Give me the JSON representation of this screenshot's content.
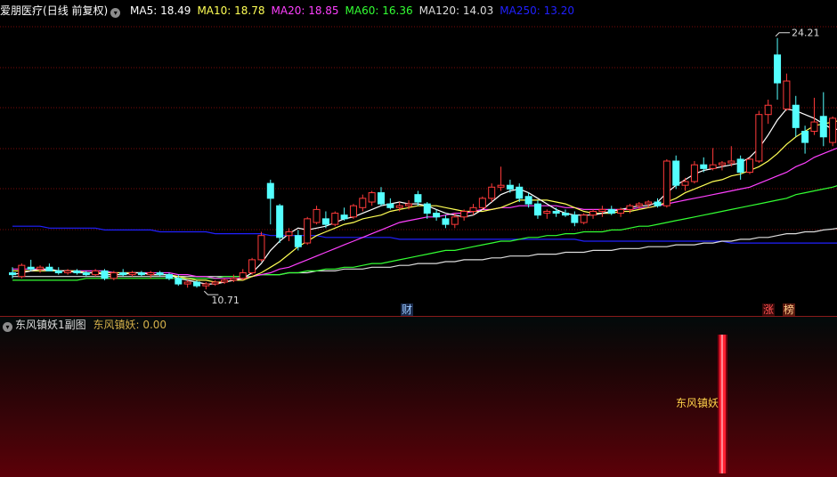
{
  "header": {
    "stock_name": "爱朋医疗",
    "period": "(日线 前复权)",
    "ma": [
      {
        "label": "MA5:",
        "value": "18.49",
        "color": "#ffffff"
      },
      {
        "label": "MA10:",
        "value": "18.78",
        "color": "#ffff55"
      },
      {
        "label": "MA20:",
        "value": "18.85",
        "color": "#ff40ff"
      },
      {
        "label": "MA60:",
        "value": "16.36",
        "color": "#33ff33"
      },
      {
        "label": "MA120:",
        "value": "14.03",
        "color": "#dddddd"
      },
      {
        "label": "MA250:",
        "value": "13.20",
        "color": "#2020ff"
      }
    ]
  },
  "sub_header": {
    "title": "东风镇妖1副图",
    "indicator_label": "东风镇妖:",
    "indicator_value": "0.00"
  },
  "annotations": {
    "high_label": "24.21",
    "low_label": "10.71",
    "fin_tag": "财",
    "zhang_tag": "涨",
    "bang_tag": "榜",
    "signal_label": "东风镇妖"
  },
  "colors": {
    "up": "#ff3a3a",
    "down": "#54ffff",
    "ma5": "#ffffff",
    "ma10": "#ffff55",
    "ma20": "#ff40ff",
    "ma60": "#33ff33",
    "ma120": "#dddddd",
    "ma250": "#2020ff",
    "grid": "#7a0a0a",
    "signal": "#ff2030"
  },
  "chart_data": {
    "type": "candlestick",
    "price_range": [
      10.0,
      25.2
    ],
    "high_marker": 24.21,
    "low_marker": 10.71,
    "candles": [
      {
        "o": 11.6,
        "h": 11.9,
        "l": 11.3,
        "c": 11.5
      },
      {
        "o": 11.4,
        "h": 12.1,
        "l": 11.3,
        "c": 12.0
      },
      {
        "o": 11.9,
        "h": 12.3,
        "l": 11.7,
        "c": 11.8
      },
      {
        "o": 11.8,
        "h": 12.0,
        "l": 11.6,
        "c": 11.9
      },
      {
        "o": 11.9,
        "h": 12.1,
        "l": 11.7,
        "c": 11.7
      },
      {
        "o": 11.7,
        "h": 11.9,
        "l": 11.5,
        "c": 11.6
      },
      {
        "o": 11.6,
        "h": 11.8,
        "l": 11.5,
        "c": 11.7
      },
      {
        "o": 11.7,
        "h": 11.8,
        "l": 11.5,
        "c": 11.6
      },
      {
        "o": 11.6,
        "h": 11.7,
        "l": 11.4,
        "c": 11.5
      },
      {
        "o": 11.5,
        "h": 11.8,
        "l": 11.4,
        "c": 11.7
      },
      {
        "o": 11.7,
        "h": 11.8,
        "l": 11.2,
        "c": 11.3
      },
      {
        "o": 11.3,
        "h": 11.7,
        "l": 11.2,
        "c": 11.6
      },
      {
        "o": 11.6,
        "h": 11.8,
        "l": 11.4,
        "c": 11.5
      },
      {
        "o": 11.5,
        "h": 11.7,
        "l": 11.4,
        "c": 11.6
      },
      {
        "o": 11.6,
        "h": 11.7,
        "l": 11.4,
        "c": 11.5
      },
      {
        "o": 11.5,
        "h": 11.7,
        "l": 11.3,
        "c": 11.6
      },
      {
        "o": 11.6,
        "h": 11.7,
        "l": 11.4,
        "c": 11.5
      },
      {
        "o": 11.5,
        "h": 11.6,
        "l": 11.2,
        "c": 11.3
      },
      {
        "o": 11.3,
        "h": 11.5,
        "l": 10.9,
        "c": 11.0
      },
      {
        "o": 11.0,
        "h": 11.2,
        "l": 10.8,
        "c": 11.1
      },
      {
        "o": 11.1,
        "h": 11.2,
        "l": 10.8,
        "c": 10.9
      },
      {
        "o": 10.9,
        "h": 11.1,
        "l": 10.71,
        "c": 11.0
      },
      {
        "o": 11.0,
        "h": 11.2,
        "l": 10.9,
        "c": 11.1
      },
      {
        "o": 11.1,
        "h": 11.3,
        "l": 11.0,
        "c": 11.2
      },
      {
        "o": 11.2,
        "h": 11.5,
        "l": 11.1,
        "c": 11.3
      },
      {
        "o": 11.3,
        "h": 11.8,
        "l": 11.2,
        "c": 11.6
      },
      {
        "o": 11.6,
        "h": 12.4,
        "l": 11.5,
        "c": 12.3
      },
      {
        "o": 12.3,
        "h": 13.8,
        "l": 12.2,
        "c": 13.6
      },
      {
        "o": 16.4,
        "h": 16.6,
        "l": 14.2,
        "c": 15.6
      },
      {
        "o": 15.2,
        "h": 15.3,
        "l": 13.2,
        "c": 13.5
      },
      {
        "o": 13.6,
        "h": 14.0,
        "l": 13.3,
        "c": 13.8
      },
      {
        "o": 13.6,
        "h": 13.9,
        "l": 12.8,
        "c": 13.0
      },
      {
        "o": 13.2,
        "h": 14.6,
        "l": 13.1,
        "c": 14.5
      },
      {
        "o": 14.3,
        "h": 15.2,
        "l": 14.2,
        "c": 15.0
      },
      {
        "o": 14.5,
        "h": 14.9,
        "l": 14.0,
        "c": 14.2
      },
      {
        "o": 14.2,
        "h": 14.9,
        "l": 14.1,
        "c": 14.8
      },
      {
        "o": 14.7,
        "h": 15.1,
        "l": 14.4,
        "c": 14.5
      },
      {
        "o": 14.6,
        "h": 15.3,
        "l": 14.5,
        "c": 15.2
      },
      {
        "o": 15.1,
        "h": 15.8,
        "l": 14.9,
        "c": 15.6
      },
      {
        "o": 15.4,
        "h": 16.0,
        "l": 15.2,
        "c": 15.9
      },
      {
        "o": 15.9,
        "h": 16.2,
        "l": 15.2,
        "c": 15.3
      },
      {
        "o": 15.3,
        "h": 15.6,
        "l": 15.0,
        "c": 15.1
      },
      {
        "o": 15.1,
        "h": 15.4,
        "l": 14.9,
        "c": 15.2
      },
      {
        "o": 15.2,
        "h": 15.5,
        "l": 15.0,
        "c": 15.3
      },
      {
        "o": 15.8,
        "h": 16.0,
        "l": 15.2,
        "c": 15.4
      },
      {
        "o": 15.3,
        "h": 15.4,
        "l": 14.5,
        "c": 14.8
      },
      {
        "o": 14.8,
        "h": 15.0,
        "l": 14.4,
        "c": 14.6
      },
      {
        "o": 14.5,
        "h": 14.7,
        "l": 14.0,
        "c": 14.2
      },
      {
        "o": 14.2,
        "h": 14.8,
        "l": 14.0,
        "c": 14.6
      },
      {
        "o": 14.6,
        "h": 15.0,
        "l": 14.4,
        "c": 14.9
      },
      {
        "o": 14.9,
        "h": 15.3,
        "l": 14.7,
        "c": 15.1
      },
      {
        "o": 15.1,
        "h": 15.7,
        "l": 15.0,
        "c": 15.6
      },
      {
        "o": 15.6,
        "h": 16.4,
        "l": 15.4,
        "c": 16.2
      },
      {
        "o": 16.2,
        "h": 17.3,
        "l": 16.0,
        "c": 16.3
      },
      {
        "o": 16.3,
        "h": 16.6,
        "l": 15.9,
        "c": 16.1
      },
      {
        "o": 16.2,
        "h": 16.4,
        "l": 15.4,
        "c": 15.6
      },
      {
        "o": 15.7,
        "h": 15.9,
        "l": 15.1,
        "c": 15.3
      },
      {
        "o": 15.3,
        "h": 15.5,
        "l": 14.5,
        "c": 14.7
      },
      {
        "o": 14.8,
        "h": 15.0,
        "l": 14.5,
        "c": 14.9
      },
      {
        "o": 14.9,
        "h": 15.1,
        "l": 14.6,
        "c": 14.8
      },
      {
        "o": 14.8,
        "h": 15.0,
        "l": 14.6,
        "c": 14.7
      },
      {
        "o": 14.7,
        "h": 14.9,
        "l": 14.1,
        "c": 14.3
      },
      {
        "o": 14.3,
        "h": 14.8,
        "l": 14.2,
        "c": 14.7
      },
      {
        "o": 14.7,
        "h": 15.0,
        "l": 14.5,
        "c": 14.9
      },
      {
        "o": 14.9,
        "h": 15.2,
        "l": 14.6,
        "c": 15.0
      },
      {
        "o": 15.0,
        "h": 15.2,
        "l": 14.7,
        "c": 14.8
      },
      {
        "o": 14.8,
        "h": 15.1,
        "l": 14.6,
        "c": 15.0
      },
      {
        "o": 15.0,
        "h": 15.3,
        "l": 14.8,
        "c": 15.2
      },
      {
        "o": 15.2,
        "h": 15.4,
        "l": 15.0,
        "c": 15.3
      },
      {
        "o": 15.3,
        "h": 15.5,
        "l": 15.1,
        "c": 15.4
      },
      {
        "o": 15.4,
        "h": 15.6,
        "l": 15.1,
        "c": 15.2
      },
      {
        "o": 15.2,
        "h": 17.7,
        "l": 15.1,
        "c": 17.6
      },
      {
        "o": 17.6,
        "h": 17.9,
        "l": 16.1,
        "c": 16.3
      },
      {
        "o": 16.3,
        "h": 16.7,
        "l": 16.0,
        "c": 16.5
      },
      {
        "o": 16.5,
        "h": 17.6,
        "l": 16.4,
        "c": 17.4
      },
      {
        "o": 17.4,
        "h": 17.8,
        "l": 17.0,
        "c": 17.2
      },
      {
        "o": 17.2,
        "h": 18.3,
        "l": 17.1,
        "c": 17.4
      },
      {
        "o": 17.4,
        "h": 17.6,
        "l": 17.1,
        "c": 17.5
      },
      {
        "o": 17.5,
        "h": 18.4,
        "l": 17.3,
        "c": 17.6
      },
      {
        "o": 17.7,
        "h": 17.9,
        "l": 16.6,
        "c": 17.0
      },
      {
        "o": 17.0,
        "h": 17.8,
        "l": 16.9,
        "c": 17.7
      },
      {
        "o": 17.6,
        "h": 20.3,
        "l": 17.5,
        "c": 20.1
      },
      {
        "o": 20.1,
        "h": 20.9,
        "l": 19.6,
        "c": 20.6
      },
      {
        "o": 23.3,
        "h": 24.21,
        "l": 20.9,
        "c": 21.8
      },
      {
        "o": 20.4,
        "h": 22.3,
        "l": 20.3,
        "c": 21.9
      },
      {
        "o": 20.6,
        "h": 21.1,
        "l": 18.9,
        "c": 19.4
      },
      {
        "o": 19.2,
        "h": 19.5,
        "l": 18.0,
        "c": 18.6
      },
      {
        "o": 19.2,
        "h": 21.0,
        "l": 19.0,
        "c": 19.7
      },
      {
        "o": 20.0,
        "h": 21.3,
        "l": 18.4,
        "c": 18.9
      },
      {
        "o": 18.6,
        "h": 20.0,
        "l": 18.4,
        "c": 19.9
      }
    ],
    "ma_lines": {
      "ma5": [
        11.5,
        11.6,
        11.7,
        11.8,
        11.8,
        11.7,
        11.7,
        11.6,
        11.6,
        11.6,
        11.5,
        11.5,
        11.5,
        11.6,
        11.6,
        11.5,
        11.5,
        11.5,
        11.3,
        11.2,
        11.1,
        11.0,
        11.0,
        11.1,
        11.2,
        11.3,
        11.6,
        12.1,
        12.8,
        13.3,
        13.7,
        14.0,
        13.9,
        14.0,
        14.1,
        14.3,
        14.5,
        14.6,
        14.8,
        15.0,
        15.2,
        15.3,
        15.4,
        15.3,
        15.3,
        15.2,
        15.0,
        14.8,
        14.7,
        14.6,
        14.7,
        15.0,
        15.4,
        15.8,
        16.0,
        16.1,
        15.9,
        15.6,
        15.3,
        15.0,
        14.8,
        14.7,
        14.7,
        14.7,
        14.8,
        14.9,
        15.0,
        15.1,
        15.2,
        15.2,
        15.4,
        15.9,
        16.3,
        16.6,
        16.9,
        17.1,
        17.2,
        17.3,
        17.4,
        17.5,
        17.8,
        18.3,
        19.0,
        19.8,
        20.4,
        20.3,
        20.1,
        19.9,
        19.6,
        19.3,
        19.3
      ],
      "ma10": [
        11.7,
        11.7,
        11.7,
        11.7,
        11.7,
        11.7,
        11.7,
        11.7,
        11.6,
        11.6,
        11.6,
        11.6,
        11.6,
        11.6,
        11.6,
        11.5,
        11.5,
        11.5,
        11.4,
        11.3,
        11.2,
        11.2,
        11.1,
        11.1,
        11.2,
        11.2,
        11.4,
        11.6,
        11.9,
        12.2,
        12.6,
        13.0,
        13.3,
        13.6,
        13.8,
        14.0,
        14.2,
        14.3,
        14.5,
        14.6,
        14.7,
        14.9,
        15.0,
        15.1,
        15.2,
        15.2,
        15.2,
        15.1,
        15.0,
        14.9,
        14.9,
        14.9,
        15.0,
        15.1,
        15.3,
        15.5,
        15.5,
        15.5,
        15.5,
        15.4,
        15.3,
        15.1,
        14.9,
        14.8,
        14.8,
        14.8,
        14.9,
        14.9,
        15.0,
        15.1,
        15.2,
        15.4,
        15.6,
        15.9,
        16.1,
        16.3,
        16.5,
        16.6,
        16.8,
        16.9,
        17.1,
        17.3,
        17.6,
        18.0,
        18.5,
        18.9,
        19.2,
        19.5,
        19.6,
        19.7,
        19.8
      ],
      "ma20": [
        11.8,
        11.8,
        11.8,
        11.8,
        11.7,
        11.7,
        11.7,
        11.7,
        11.7,
        11.7,
        11.7,
        11.6,
        11.6,
        11.6,
        11.6,
        11.6,
        11.6,
        11.6,
        11.5,
        11.5,
        11.4,
        11.4,
        11.3,
        11.3,
        11.3,
        11.3,
        11.4,
        11.5,
        11.6,
        11.8,
        11.9,
        12.1,
        12.3,
        12.5,
        12.7,
        12.9,
        13.1,
        13.3,
        13.5,
        13.7,
        13.9,
        14.1,
        14.3,
        14.4,
        14.5,
        14.6,
        14.6,
        14.7,
        14.8,
        14.8,
        14.9,
        15.0,
        15.0,
        15.1,
        15.1,
        15.2,
        15.2,
        15.2,
        15.2,
        15.2,
        15.1,
        15.1,
        15.0,
        15.0,
        15.0,
        15.0,
        15.0,
        15.0,
        15.1,
        15.1,
        15.2,
        15.3,
        15.4,
        15.5,
        15.6,
        15.7,
        15.8,
        15.9,
        16.0,
        16.1,
        16.2,
        16.4,
        16.6,
        16.8,
        17.0,
        17.3,
        17.5,
        17.8,
        18.0,
        18.2,
        18.4
      ],
      "ma60": [
        11.2,
        11.2,
        11.2,
        11.2,
        11.2,
        11.2,
        11.2,
        11.2,
        11.3,
        11.3,
        11.3,
        11.3,
        11.3,
        11.3,
        11.3,
        11.3,
        11.3,
        11.3,
        11.3,
        11.3,
        11.3,
        11.3,
        11.3,
        11.4,
        11.4,
        11.4,
        11.4,
        11.5,
        11.5,
        11.5,
        11.6,
        11.6,
        11.7,
        11.7,
        11.8,
        11.8,
        11.9,
        11.9,
        12.0,
        12.1,
        12.1,
        12.2,
        12.3,
        12.4,
        12.5,
        12.6,
        12.7,
        12.8,
        12.8,
        12.9,
        13.0,
        13.1,
        13.2,
        13.3,
        13.3,
        13.4,
        13.5,
        13.5,
        13.6,
        13.6,
        13.7,
        13.7,
        13.8,
        13.8,
        13.8,
        13.9,
        13.9,
        14.0,
        14.1,
        14.1,
        14.2,
        14.3,
        14.4,
        14.5,
        14.6,
        14.7,
        14.8,
        14.9,
        15.0,
        15.1,
        15.2,
        15.3,
        15.4,
        15.5,
        15.6,
        15.8,
        15.9,
        16.0,
        16.1,
        16.2,
        16.36
      ],
      "ma120": [
        11.4,
        11.4,
        11.4,
        11.4,
        11.4,
        11.4,
        11.4,
        11.4,
        11.4,
        11.4,
        11.4,
        11.4,
        11.4,
        11.4,
        11.4,
        11.4,
        11.4,
        11.4,
        11.4,
        11.4,
        11.4,
        11.4,
        11.4,
        11.4,
        11.4,
        11.4,
        11.4,
        11.5,
        11.5,
        11.5,
        11.6,
        11.6,
        11.6,
        11.7,
        11.7,
        11.7,
        11.8,
        11.8,
        11.8,
        11.9,
        11.9,
        11.9,
        12.0,
        12.0,
        12.1,
        12.1,
        12.1,
        12.2,
        12.2,
        12.3,
        12.3,
        12.3,
        12.4,
        12.4,
        12.5,
        12.5,
        12.5,
        12.6,
        12.6,
        12.6,
        12.7,
        12.7,
        12.7,
        12.8,
        12.8,
        12.8,
        12.9,
        12.9,
        12.9,
        13.0,
        13.0,
        13.0,
        13.1,
        13.1,
        13.1,
        13.2,
        13.2,
        13.3,
        13.3,
        13.4,
        13.4,
        13.5,
        13.5,
        13.6,
        13.7,
        13.7,
        13.8,
        13.8,
        13.9,
        13.95,
        14.03
      ],
      "ma250": [
        14.1,
        14.1,
        14.1,
        14.1,
        14.0,
        14.0,
        14.0,
        14.0,
        14.0,
        14.0,
        13.9,
        13.9,
        13.9,
        13.9,
        13.9,
        13.9,
        13.8,
        13.8,
        13.8,
        13.8,
        13.8,
        13.8,
        13.7,
        13.7,
        13.7,
        13.7,
        13.7,
        13.7,
        13.6,
        13.6,
        13.6,
        13.6,
        13.6,
        13.6,
        13.5,
        13.5,
        13.5,
        13.5,
        13.5,
        13.5,
        13.5,
        13.5,
        13.4,
        13.4,
        13.4,
        13.4,
        13.4,
        13.4,
        13.4,
        13.4,
        13.4,
        13.4,
        13.4,
        13.4,
        13.4,
        13.4,
        13.4,
        13.4,
        13.4,
        13.4,
        13.4,
        13.4,
        13.3,
        13.3,
        13.3,
        13.3,
        13.3,
        13.3,
        13.3,
        13.3,
        13.3,
        13.3,
        13.3,
        13.3,
        13.3,
        13.3,
        13.3,
        13.3,
        13.2,
        13.2,
        13.2,
        13.2,
        13.2,
        13.2,
        13.2,
        13.2,
        13.2,
        13.2,
        13.2,
        13.2,
        13.2
      ]
    },
    "indicator": {
      "name": "东风镇妖",
      "signal_index": 77,
      "signal_value": 1
    }
  }
}
